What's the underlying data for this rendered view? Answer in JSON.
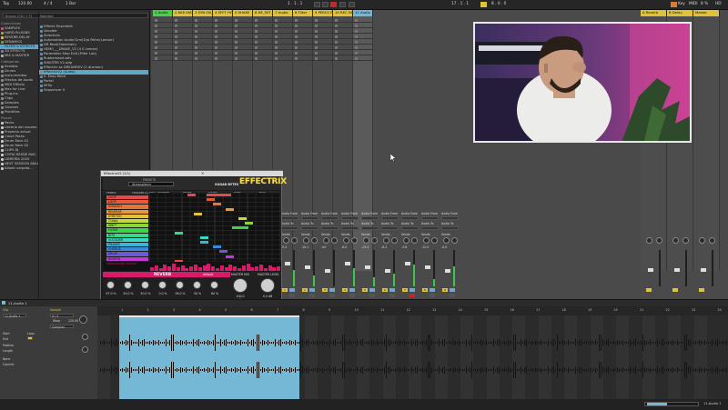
{
  "transport": {
    "tap": "Tap",
    "tempo": "120.00",
    "sig": "4 / 4",
    "quant": "1 Bar",
    "position": "1 . 1 . 1",
    "key": "Key",
    "midi": "MIDI",
    "cpu": "8 %",
    "hd": "HD",
    "loop_start": "17 . 1 . 1",
    "loop_len": "8 . 0 . 0"
  },
  "browser": {
    "search": "Buscar (Ctrl + F)",
    "col_header": "Nombre",
    "collections_label": "Colecciones",
    "collections": [
      {
        "label": "SAMPLES",
        "color": "#e05454"
      },
      {
        "label": "HARD PLUGINS",
        "color": "#e08d3a"
      },
      {
        "label": "REVERB DELAY",
        "color": "#e0c23a"
      },
      {
        "label": "DYNAMICS",
        "color": "#52b84c"
      },
      {
        "label": "FILTER & EFFECTS",
        "color": "#46a7d6"
      },
      {
        "label": "3D EFFECTS",
        "color": "#8a6ad6"
      },
      {
        "label": "MIX & MASTER",
        "color": "#b0b0b0"
      }
    ],
    "categories_label": "Categorías",
    "categories": [
      "Sonidos",
      "Drums",
      "Instrumentos",
      "Efectos de Audio",
      "MIDI Effects",
      "Max for Live",
      "Plug-ins",
      "Clips",
      "Samples",
      "Grooves",
      "Plantillas"
    ],
    "places_label": "Places",
    "places": [
      "Packs",
      "Librería del usuario",
      "Proyecto actual",
      "Cloud Packs",
      "Drum Rack 01",
      "Drum Rack 02",
      "CLIPS DJ",
      "COPIA DESDE MAC",
      "LIBRERÍA 2020",
      "NEXT SESSION ANLA",
      "Añadir carpeta…"
    ],
    "files": [
      "Effects Ensemble",
      "Vocoder",
      "Sidechain",
      "Automation Audio Drm(D)a Rhtm(Lamorr)",
      "DR Beat(Sidechain)",
      "HEMO___DRAKE_V2 (4 0 Lemon)",
      "Parameter Step Edit (Filter Lab)",
      "Rubberband.adv",
      "SHIKITER V2.adg",
      "Effectrix as DREAMREV (2.4Lemon)",
      "Audio Effect Rack",
      "Ir. Eexo Reed",
      "Portal",
      "MiTur",
      "Sequencer II"
    ],
    "selected_file": "EffectrixV2 (Audio)"
  },
  "tracks": [
    {
      "name": "1 Audio",
      "color": "#4ccd4c"
    },
    {
      "name": "2 808 HIAT",
      "color": "#e0c23a"
    },
    {
      "name": "3 SYN OB_HARM",
      "color": "#e0c23a"
    },
    {
      "name": "4 SFFT HIT",
      "color": "#e0c23a"
    },
    {
      "name": "5 SHAKE",
      "color": "#e0c23a"
    },
    {
      "name": "6 DE_SET_8",
      "color": "#e0c23a"
    },
    {
      "name": "7 Audio",
      "color": "#e0c23a"
    },
    {
      "name": "8 Tilter",
      "color": "#e0c23a"
    },
    {
      "name": "9 PERCS FUNK",
      "color": "#e0c23a"
    },
    {
      "name": "10 REC NOTCH",
      "color": "#e0c23a"
    },
    {
      "name": "11 Audio",
      "color": "#74b8d6"
    }
  ],
  "returns": [
    {
      "name": "A Reverb",
      "color": "#e0c23a"
    },
    {
      "name": "B Delay",
      "color": "#e0c23a"
    },
    {
      "name": "Master",
      "color": "#e0c23a"
    }
  ],
  "mixer": {
    "audio_from": "Audio From",
    "ext_in": "Ext. In",
    "monitor": "Monitor",
    "audio_to": "Audio To",
    "master": "Master",
    "sends": "Sends",
    "db_values": [
      "-5.2",
      "-10.1",
      "-inf",
      "-6.0",
      "-13.4",
      "-8.2",
      "-3.8",
      "-12.0",
      "-0.0"
    ],
    "track_nums": [
      "1",
      "2",
      "3",
      "4",
      "5",
      "6",
      "7",
      "8",
      "9"
    ]
  },
  "plugin": {
    "title": "EffectrixV2 (2/1)",
    "preset_label": "PRESETS",
    "preset_name": "Atmospheric",
    "brand": "SUGAR BYTES",
    "product": "EFFECTRIX",
    "top_labels": [
      "TEMPO",
      "TRIGGER by MIDI",
      "PATTERN",
      "RESET",
      "SWING",
      "STEP",
      "EDIT"
    ],
    "effects": [
      {
        "name": "LOOP",
        "color": "#e64a4a"
      },
      {
        "name": "LOOP",
        "color": "#e65a3a"
      },
      {
        "name": "SCRATCH",
        "color": "#e6733a"
      },
      {
        "name": "REVERSE",
        "color": "#e69a3a"
      },
      {
        "name": "STRETCH",
        "color": "#e6c23a"
      },
      {
        "name": "TONAL",
        "color": "#c6d83a"
      },
      {
        "name": "SHIFT",
        "color": "#8ad63a"
      },
      {
        "name": "FILTER",
        "color": "#3ad64a"
      },
      {
        "name": "BITS",
        "color": "#3ad68a"
      },
      {
        "name": "VOCODER",
        "color": "#3ad6c2"
      },
      {
        "name": "PHASER",
        "color": "#3ab6d6"
      },
      {
        "name": "CHORUS",
        "color": "#3a8ad6"
      },
      {
        "name": "DELAY",
        "color": "#6a5ad6"
      },
      {
        "name": "REVERB",
        "color": "#c23ad6"
      }
    ],
    "modulation_label": "MODULATION TRACKS",
    "mod_labels": [
      "FOLLOW",
      "ENV",
      "SYNC"
    ],
    "section_name": "REVERB",
    "section_mode": "default",
    "knob_labels": [
      "SIZE",
      "DAMP",
      "WIDTH",
      "PRE",
      "MIX"
    ],
    "knob_values": [
      "97.0 %",
      "50.0 %",
      "50.0 %",
      "0.0 %",
      "36.0 %",
      "50 %",
      "60 %"
    ],
    "master_mix_label": "MASTER MIX",
    "master_level_label": "MASTER LEVEL",
    "master_mix_value": "100.0 %",
    "master_level_value": "0.0 dB"
  },
  "clip": {
    "name": "11-Audio 1",
    "clip_label": "Clip",
    "sample_label": "Sample",
    "signature": "4 / 4",
    "groove": "None",
    "commit": "Commit",
    "warp": "Warp",
    "seg_bpm": "120.00",
    "complex": "Complex",
    "start": "Start",
    "end": "End",
    "loop": "Loop",
    "position": "Position",
    "length": "Length",
    "ruler_marks": [
      "1",
      "2",
      "3",
      "4",
      "5",
      "6",
      "7",
      "8",
      "9",
      "10",
      "11",
      "12",
      "13",
      "14",
      "15",
      "16",
      "17",
      "18",
      "19",
      "20",
      "21",
      "22",
      "23",
      "24"
    ],
    "bottom_label": "11-Audio 1"
  }
}
